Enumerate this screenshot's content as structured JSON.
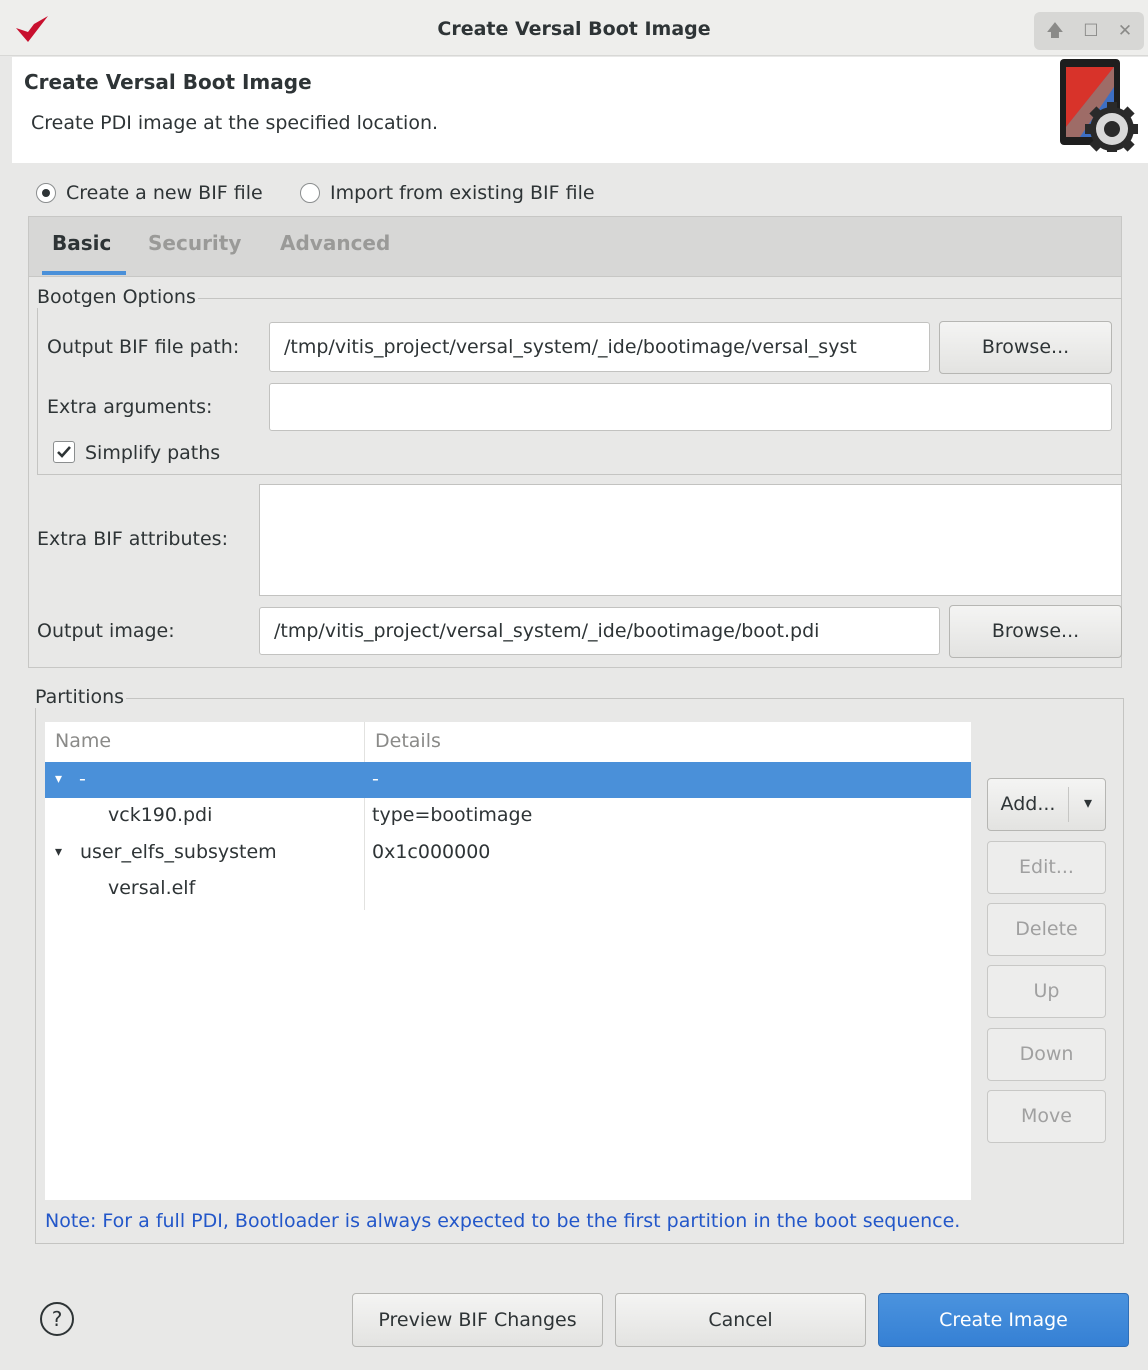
{
  "window": {
    "title": "Create Versal Boot Image",
    "controls": {
      "pin": "🡅",
      "maximize": "☐",
      "close": "✕"
    }
  },
  "header": {
    "title": "Create Versal Boot Image",
    "description": "Create PDI image at the specified location."
  },
  "bif_mode": {
    "options": [
      "Create a new BIF file",
      "Import from existing BIF file"
    ],
    "selected": "Create a new BIF file"
  },
  "tabs": [
    {
      "label": "Basic",
      "active": true
    },
    {
      "label": "Security",
      "active": false
    },
    {
      "label": "Advanced",
      "active": false
    }
  ],
  "bootgen": {
    "group_label": "Bootgen Options",
    "output_bif_label": "Output BIF file path:",
    "output_bif_value": "/tmp/vitis_project/versal_system/_ide/bootimage/versal_syst",
    "browse_label": "Browse...",
    "extra_args_label": "Extra arguments:",
    "extra_args_value": "",
    "simplify_paths_label": "Simplify paths",
    "simplify_paths_checked": true
  },
  "extra_bif": {
    "label": "Extra BIF attributes:",
    "value": ""
  },
  "output_image": {
    "label": "Output image:",
    "value": "/tmp/vitis_project/versal_system/_ide/bootimage/boot.pdi",
    "browse_label": "Browse..."
  },
  "partitions": {
    "group_label": "Partitions",
    "columns": [
      "Name",
      "Details"
    ],
    "rows": [
      {
        "name": "-",
        "details": "-",
        "expander": "▾",
        "selected": true
      },
      {
        "name": "vck190.pdi",
        "details": "type=bootimage",
        "expander": "",
        "selected": false
      },
      {
        "name": "user_elfs_subsystem",
        "details": "0x1c000000",
        "expander": "▾",
        "selected": false
      },
      {
        "name": "versal.elf",
        "details": "",
        "expander": "",
        "selected": false
      }
    ],
    "buttons": {
      "add": "Add...",
      "add_dropdown": "▾",
      "edit": "Edit...",
      "delete": "Delete",
      "up": "Up",
      "down": "Down",
      "move": "Move"
    },
    "note": "Note: For a full PDI, Bootloader is always expected to be the first partition in the boot sequence."
  },
  "footer": {
    "help": "?",
    "preview": "Preview BIF Changes",
    "cancel": "Cancel",
    "create": "Create Image"
  },
  "colors": {
    "accent": "#4a90d9",
    "note": "#2357c9",
    "logo": "#c8102e"
  }
}
